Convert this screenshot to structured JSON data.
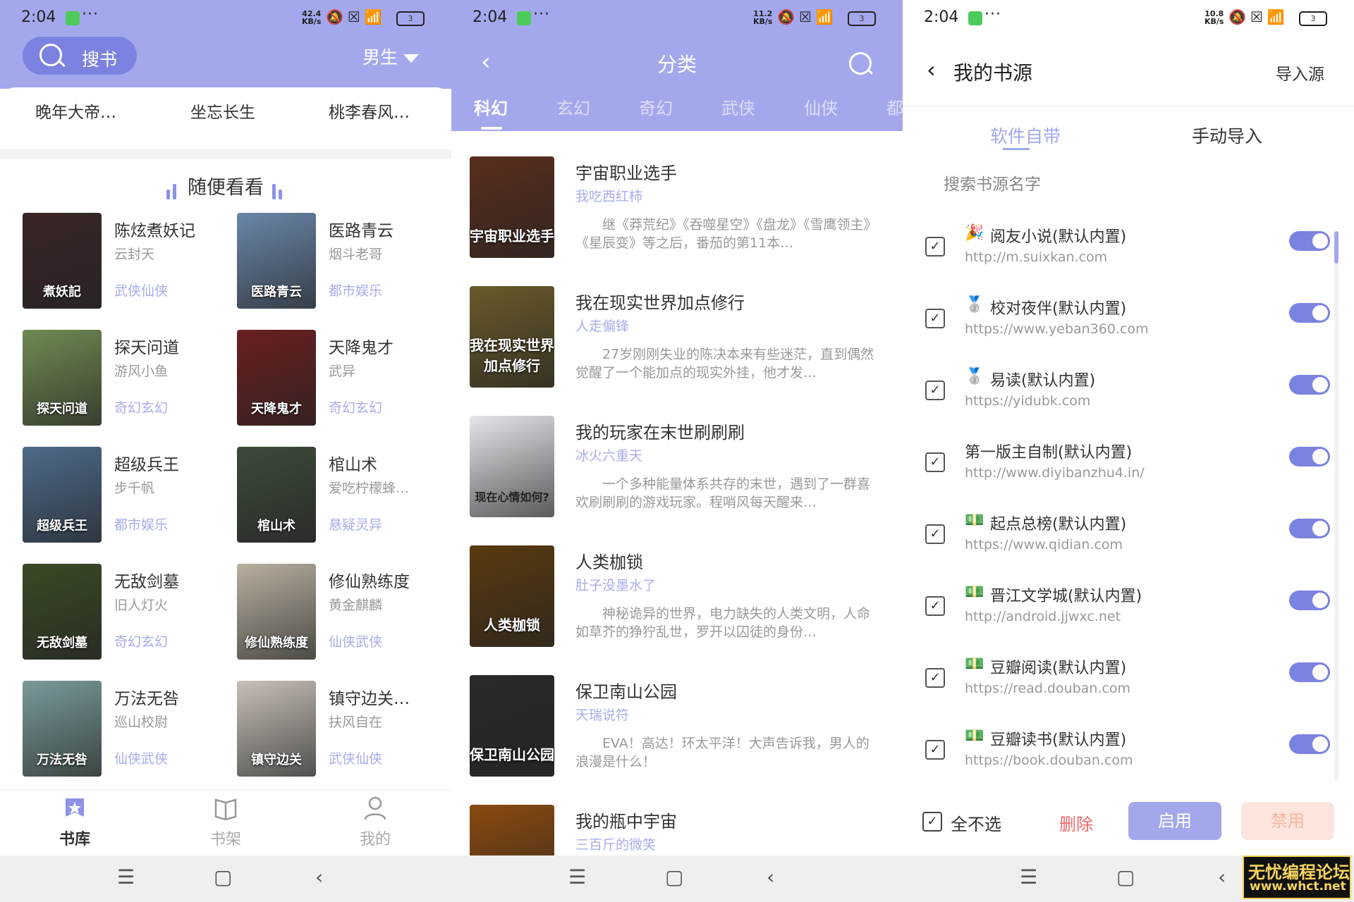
{
  "status_bars": [
    {
      "time": "2:04",
      "more": "···",
      "speed_top": "42.4",
      "speed_bottom": "KB/s",
      "battery": "3"
    },
    {
      "time": "2:04",
      "more": "···",
      "speed_top": "11.2",
      "speed_bottom": "KB/s",
      "battery": "3"
    },
    {
      "time": "2:04",
      "more": "···",
      "speed_top": "10.8",
      "speed_bottom": "KB/s",
      "battery": "3"
    }
  ],
  "library": {
    "search_label": "搜书",
    "gender": "男生",
    "hot_titles": [
      "晚年大帝…",
      "坐忘长生",
      "桃李春风…"
    ],
    "section_title": "随便看看",
    "books": [
      {
        "title": "陈炫煮妖记",
        "author": "云封天",
        "genre": "武侠仙侠",
        "cover_text": "煮妖記",
        "color": "#3a2626"
      },
      {
        "title": "医路青云",
        "author": "烟斗老哥",
        "genre": "都市娱乐",
        "cover_text": "医路青云",
        "color": "#6a86a8"
      },
      {
        "title": "探天问道",
        "author": "游风小鱼",
        "genre": "奇幻玄幻",
        "cover_text": "探天问道",
        "color": "#6f8a52"
      },
      {
        "title": "天降鬼才",
        "author": "武异",
        "genre": "奇幻玄幻",
        "cover_text": "天降鬼才",
        "color": "#6a2020"
      },
      {
        "title": "超级兵王",
        "author": "步千帆",
        "genre": "都市娱乐",
        "cover_text": "超级兵王",
        "color": "#4e6a8a"
      },
      {
        "title": "棺山术",
        "author": "爱吃柠檬蜂…",
        "genre": "悬疑灵异",
        "cover_text": "棺山术",
        "color": "#3d4a3a"
      },
      {
        "title": "无敌剑墓",
        "author": "旧人灯火",
        "genre": "奇幻玄幻",
        "cover_text": "无敌剑墓",
        "color": "#3a4a26"
      },
      {
        "title": "修仙熟练度",
        "author": "黄金麒麟",
        "genre": "仙侠武侠",
        "cover_text": "修仙熟练度",
        "color": "#b8b0a0"
      },
      {
        "title": "万法无咎",
        "author": "巡山校尉",
        "genre": "仙侠武侠",
        "cover_text": "万法无咎",
        "color": "#7a9a9a"
      },
      {
        "title": "镇守边关…",
        "author": "扶风自在",
        "genre": "武侠仙侠",
        "cover_text": "镇守边关",
        "color": "#c8c0b8"
      }
    ],
    "tabs": [
      {
        "label": "书库",
        "active": true
      },
      {
        "label": "书架",
        "active": false
      },
      {
        "label": "我的",
        "active": false
      }
    ]
  },
  "category": {
    "back": "‹",
    "title": "分类",
    "tabs": [
      "科幻",
      "玄幻",
      "奇幻",
      "武侠",
      "仙侠",
      "都"
    ],
    "books": [
      {
        "title": "宇宙职业选手",
        "author": "我吃西红柿",
        "desc": "继《莽荒纪》《吞噬星空》《盘龙》《雪鹰领主》《星辰变》等之后，番茄的第11本…",
        "cover_text": "宇宙职业选手",
        "color": "#5a2e1e"
      },
      {
        "title": "我在现实世界加点修行",
        "author": "人走偏锋",
        "desc": "27岁刚刚失业的陈决本来有些迷茫，直到偶然觉醒了一个能加点的现实外挂，他才发…",
        "cover_text": "我在现实世界加点修行",
        "color": "#6a5a2a"
      },
      {
        "title": "我的玩家在末世刷刷刷",
        "author": "冰火六重天",
        "desc": "一个多种能量体系共存的末世，遇到了一群喜欢刷刷刷的游戏玩家。程哨风每天醒来…",
        "cover_text": "现在心情如何?",
        "color": "#e8e4ec"
      },
      {
        "title": "人类枷锁",
        "author": "肚子没墨水了",
        "desc": "神秘诡异的世界，电力缺失的人类文明，人命如草芥的狰狞乱世，罗开以囚徒的身份…",
        "cover_text": "人类枷锁",
        "color": "#5a3a10"
      },
      {
        "title": "保卫南山公园",
        "author": "天瑞说符",
        "desc": "EVA！高达！环太平洋！大声告诉我，男人的浪漫是什么！",
        "cover_text": "保卫南山公园",
        "color": "#2a2a2a"
      },
      {
        "title": "我的瓶中宇宙",
        "author": "三百斤的微笑",
        "desc": "",
        "cover_text": "",
        "color": "#8a4a10"
      }
    ]
  },
  "sources": {
    "back": "‹",
    "title": "我的书源",
    "import": "导入源",
    "tab_builtin": "软件自带",
    "tab_manual": "手动导入",
    "search_placeholder": "搜索书源名字",
    "items": [
      {
        "icon": "🎉",
        "name": "阅友小说(默认内置)",
        "url": "http://m.suixkan.com",
        "enabled": true
      },
      {
        "icon": "🥈",
        "name": "校对夜伴(默认内置)",
        "url": "https://www.yeban360.com",
        "enabled": true
      },
      {
        "icon": "🥈",
        "name": "易读(默认内置)",
        "url": "https://yidubk.com",
        "enabled": true
      },
      {
        "icon": "",
        "name": "第一版主自制(默认内置)",
        "url": "http://www.diyibanzhu4.in/",
        "enabled": true
      },
      {
        "icon": "💵",
        "name": "起点总榜(默认内置)",
        "url": "https://www.qidian.com",
        "enabled": true
      },
      {
        "icon": "💵",
        "name": "晋江文学城(默认内置)",
        "url": "http://android.jjwxc.net",
        "enabled": true
      },
      {
        "icon": "💵",
        "name": "豆瓣阅读(默认内置)",
        "url": "https://read.douban.com",
        "enabled": true
      },
      {
        "icon": "💵",
        "name": "豆瓣读书(默认内置)",
        "url": "https://book.douban.com",
        "enabled": true
      }
    ],
    "select_none": "全不选",
    "delete": "删除",
    "enable": "启用",
    "disable": "禁用"
  },
  "watermark": {
    "line1": "无忧编程论坛",
    "line2": "www.whct.net"
  },
  "colors": {
    "accent": "#a3a8ec",
    "accent_dark": "#7c82e0",
    "genre": "#a8acea",
    "delete": "#ee6666"
  }
}
